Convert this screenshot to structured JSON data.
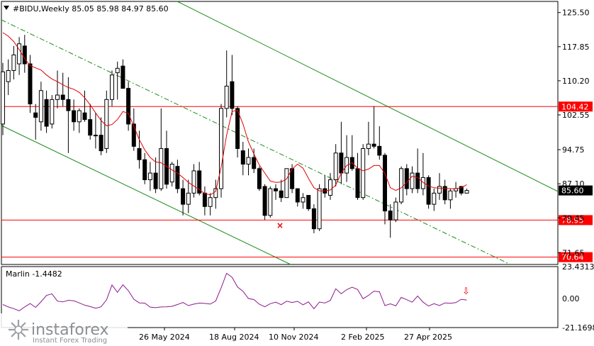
{
  "chart_data": {
    "type": "candlestick",
    "symbol": "#BIDU,Weekly",
    "ohlc_header": {
      "open": "85.05",
      "high": "85.98",
      "low": "84.97",
      "close": "85.60"
    },
    "y_ticks": [
      "125.50",
      "117.85",
      "110.20",
      "102.55",
      "94.75",
      "87.10",
      "79.45",
      "71.65"
    ],
    "x_ticks": [
      "26 May 2024",
      "18 Aug 2024",
      "10 Nov 2024",
      "2 Feb 2025",
      "27 Apr 2025"
    ],
    "ylim": [
      69.0,
      128.0
    ],
    "current_price": "85.60",
    "levels": [
      {
        "value": 104.42,
        "label": "104.42",
        "color": "#ff0000"
      },
      {
        "value": 78.95,
        "label": "78.95",
        "color": "#ff0000"
      },
      {
        "value": 70.64,
        "label": "70.64",
        "color": "#ff0000"
      }
    ],
    "candles": [
      [
        100.5,
        114.2,
        98.0,
        112.2
      ],
      [
        110.0,
        115.0,
        107.0,
        112.5
      ],
      [
        112.5,
        118.0,
        110.5,
        116.0
      ],
      [
        114.0,
        120.0,
        111.5,
        118.5
      ],
      [
        118.0,
        120.5,
        112.0,
        114.0
      ],
      [
        114.0,
        116.0,
        103.0,
        105.0
      ],
      [
        103.0,
        105.0,
        97.0,
        102.0
      ],
      [
        101.0,
        110.0,
        99.0,
        108.0
      ],
      [
        106.0,
        108.0,
        98.5,
        100.0
      ],
      [
        100.5,
        107.0,
        99.5,
        106.0
      ],
      [
        106.0,
        112.5,
        104.0,
        107.0
      ],
      [
        107.0,
        112.0,
        104.5,
        106.0
      ],
      [
        106.0,
        111.0,
        94.0,
        103.5
      ],
      [
        103.5,
        106.0,
        99.0,
        101.0
      ],
      [
        101.0,
        104.0,
        98.5,
        103.5
      ],
      [
        103.0,
        108.0,
        101.0,
        101.5
      ],
      [
        101.5,
        105.0,
        97.0,
        98.0
      ],
      [
        98.0,
        103.0,
        95.0,
        98.0
      ],
      [
        98.0,
        102.0,
        93.5,
        94.5
      ],
      [
        95.0,
        108.0,
        94.0,
        106.0
      ],
      [
        106.0,
        112.5,
        104.5,
        111.5
      ],
      [
        112.0,
        114.5,
        106.0,
        113.0
      ],
      [
        113.5,
        115.0,
        108.5,
        108.5
      ],
      [
        108.5,
        110.0,
        99.0,
        100.5
      ],
      [
        100.5,
        104.0,
        94.5,
        95.5
      ],
      [
        95.0,
        99.0,
        90.5,
        92.5
      ],
      [
        92.5,
        94.0,
        87.0,
        88.0
      ],
      [
        88.0,
        92.0,
        85.5,
        89.5
      ],
      [
        89.5,
        93.0,
        85.0,
        86.0
      ],
      [
        86.0,
        104.0,
        85.5,
        95.0
      ],
      [
        95.0,
        99.0,
        86.0,
        87.0
      ],
      [
        87.5,
        92.0,
        86.5,
        91.5
      ],
      [
        91.0,
        92.5,
        85.0,
        86.0
      ],
      [
        86.0,
        88.0,
        80.0,
        82.5
      ],
      [
        82.5,
        88.0,
        80.5,
        85.0
      ],
      [
        85.0,
        91.5,
        84.0,
        90.0
      ],
      [
        90.0,
        92.0,
        84.5,
        85.0
      ],
      [
        85.0,
        86.5,
        80.0,
        82.0
      ],
      [
        82.0,
        85.0,
        80.0,
        84.0
      ],
      [
        84.0,
        88.0,
        81.5,
        86.0
      ],
      [
        86.0,
        105.0,
        84.0,
        104.0
      ],
      [
        104.0,
        117.0,
        102.0,
        109.0
      ],
      [
        110.0,
        116.0,
        102.5,
        104.0
      ],
      [
        104.0,
        104.5,
        93.0,
        95.0
      ],
      [
        94.5,
        96.5,
        89.0,
        91.5
      ],
      [
        91.5,
        95.0,
        89.0,
        93.0
      ],
      [
        93.0,
        95.0,
        89.5,
        90.5
      ],
      [
        90.5,
        91.0,
        85.5,
        86.0
      ],
      [
        86.5,
        87.0,
        79.0,
        80.0
      ],
      [
        80.0,
        86.5,
        79.5,
        86.0
      ],
      [
        86.0,
        87.0,
        83.5,
        85.5
      ],
      [
        85.5,
        88.0,
        83.0,
        84.0
      ],
      [
        84.0,
        90.5,
        84.0,
        90.5
      ],
      [
        90.5,
        91.5,
        85.0,
        86.0
      ],
      [
        86.0,
        86.0,
        82.0,
        83.0
      ],
      [
        83.0,
        85.0,
        81.5,
        84.0
      ],
      [
        84.5,
        84.5,
        81.0,
        81.5
      ],
      [
        81.5,
        82.5,
        76.0,
        77.0
      ],
      [
        77.0,
        87.0,
        76.5,
        86.0
      ],
      [
        86.0,
        89.0,
        84.0,
        85.0
      ],
      [
        84.5,
        89.5,
        83.5,
        88.0
      ],
      [
        88.0,
        96.0,
        86.5,
        94.0
      ],
      [
        94.0,
        101.0,
        87.0,
        89.5
      ],
      [
        89.5,
        98.0,
        87.5,
        93.0
      ],
      [
        93.0,
        98.0,
        90.0,
        90.5
      ],
      [
        90.5,
        94.0,
        83.5,
        84.0
      ],
      [
        84.0,
        96.0,
        83.5,
        95.0
      ],
      [
        95.0,
        101.0,
        93.5,
        96.0
      ],
      [
        96.0,
        104.5,
        95.0,
        95.5
      ],
      [
        95.5,
        100.0,
        92.5,
        93.5
      ],
      [
        93.5,
        94.0,
        78.0,
        81.0
      ],
      [
        81.0,
        82.5,
        75.0,
        79.0
      ],
      [
        79.0,
        84.0,
        78.5,
        83.0
      ],
      [
        83.0,
        91.0,
        82.5,
        90.5
      ],
      [
        90.5,
        91.5,
        84.5,
        86.0
      ],
      [
        86.0,
        91.0,
        85.0,
        89.5
      ],
      [
        89.5,
        95.0,
        85.0,
        86.0
      ],
      [
        86.0,
        94.0,
        84.5,
        88.5
      ],
      [
        88.5,
        89.0,
        81.5,
        82.5
      ],
      [
        82.5,
        86.0,
        81.0,
        85.0
      ],
      [
        85.0,
        89.5,
        83.5,
        86.5
      ],
      [
        86.5,
        88.0,
        82.5,
        83.5
      ],
      [
        83.5,
        86.0,
        81.5,
        85.5
      ],
      [
        85.5,
        87.5,
        84.0,
        86.0
      ],
      [
        86.5,
        86.5,
        84.5,
        85.0
      ],
      [
        85.0,
        85.98,
        84.97,
        85.6
      ]
    ],
    "ma_values": [
      121,
      120.2,
      119,
      117.2,
      115.2,
      113.6,
      113.1,
      112.6,
      111.5,
      110.6,
      110.0,
      109.3,
      108.7,
      108.3,
      107.6,
      106.4,
      104.8,
      103.0,
      101.3,
      100.1,
      100.4,
      101.5,
      103.3,
      102.9,
      100.0,
      97.0,
      94.7,
      93.0,
      92.0,
      91.8,
      91.0,
      90.2,
      89.5,
      88.5,
      87.4,
      86.6,
      85.8,
      84.9,
      84.6,
      85.4,
      90.8,
      98.0,
      103.3,
      103.6,
      100.5,
      96.5,
      93.8,
      91.3,
      89.5,
      87.7,
      87.4,
      87.5,
      88.2,
      90.4,
      91.5,
      90.6,
      88.3,
      86.2,
      85.5,
      85.5,
      85.7,
      86.8,
      89.5,
      91.2,
      91.8,
      90.6,
      90.0,
      90.4,
      91.2,
      91.2,
      89.4,
      86.2,
      85.6,
      86.2,
      87.4,
      88.8,
      88.5,
      87.4,
      86.6,
      86.2,
      86.1,
      86.1,
      86.0,
      86.0,
      86.2,
      86.9
    ],
    "indicator": {
      "name": "Marlin -1.4482",
      "y_ticks": [
        "23.4313",
        "0.00",
        "-21.1698"
      ],
      "ylim": [
        -21.1698,
        23.4313
      ],
      "values": [
        -4.3,
        -6.1,
        -7.3,
        -8.9,
        -6.1,
        -3.6,
        -6.4,
        -2.3,
        2.3,
        3.5,
        -1.8,
        -2.4,
        -1.2,
        -1.6,
        -3.1,
        -4.8,
        -5.8,
        -7.0,
        -6.0,
        -0.9,
        10.0,
        4.6,
        10.1,
        5.8,
        -0.4,
        -3.1,
        -3.3,
        -6.2,
        -6.6,
        -6.1,
        -6.0,
        -5.6,
        -4.3,
        -2.8,
        -5.1,
        -4.0,
        -3.3,
        -3.5,
        -4.0,
        -1.7,
        8.0,
        18.5,
        15.6,
        8.5,
        5.4,
        0.1,
        -0.7,
        -4.1,
        -6.0,
        -3.7,
        -2.6,
        -4.4,
        -1.9,
        -2.8,
        -2.0,
        -4.5,
        -2.4,
        -7.4,
        -2.5,
        -3.2,
        -1.3,
        7.2,
        3.5,
        6.6,
        8.4,
        6.7,
        -0.1,
        2.4,
        5.5,
        5.0,
        -5.1,
        -3.8,
        -5.3,
        0.9,
        -0.8,
        -2.6,
        1.9,
        -2.6,
        -5.4,
        -3.7,
        -5.1,
        -3.1,
        -3.4,
        -2.9,
        -0.5,
        -1.1
      ]
    }
  },
  "ui": {
    "title": "#BIDU,Weekly  85.05 85.98 84.97 85.60",
    "price_badge": "85.60",
    "marker": "×",
    "arrow": "⇩",
    "watermark_brand": "instaforex",
    "watermark_tagline": "Instant Forex Trading"
  }
}
